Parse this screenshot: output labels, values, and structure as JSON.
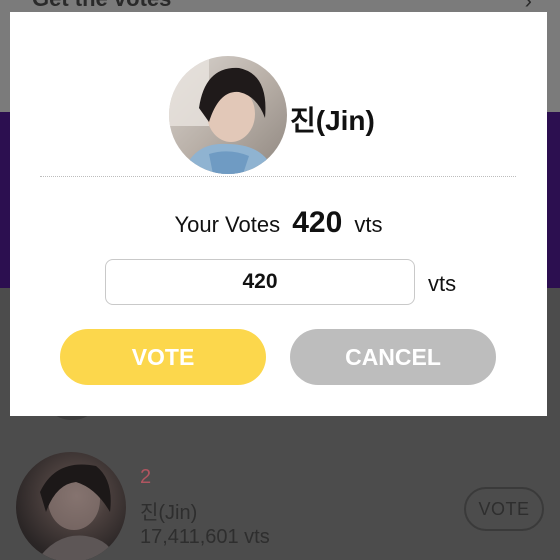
{
  "background": {
    "header_title": "Get the votes",
    "list_row": {
      "rank": "2",
      "name": "진(Jin)",
      "votes": "17,411,601 vts",
      "vote_button_label": "VOTE"
    }
  },
  "modal": {
    "name": "진(Jin)",
    "your_votes_label": "Your Votes",
    "your_votes_value": "420",
    "your_votes_unit": "vts",
    "input_value": "420",
    "input_unit": "vts",
    "vote_button_label": "VOTE",
    "cancel_button_label": "CANCEL"
  },
  "colors": {
    "vote_button": "#fcd74c",
    "cancel_button": "#bdbdbd",
    "rank_text": "#b05560",
    "banner": "#2c0f50"
  }
}
